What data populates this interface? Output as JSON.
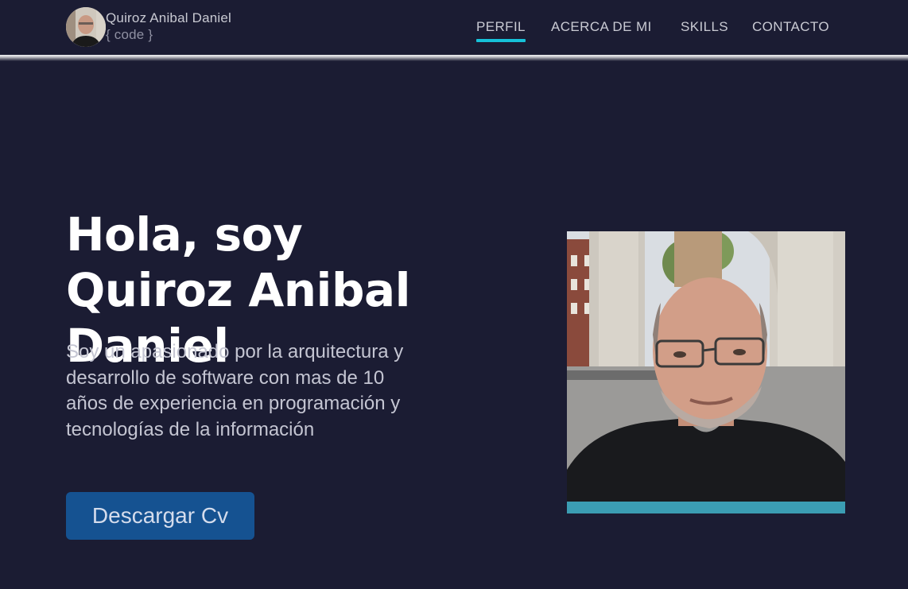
{
  "brand": {
    "name": "Quiroz Anibal Daniel",
    "tagline": "{ code }"
  },
  "nav": {
    "items": [
      {
        "label": "PERFIL",
        "active": true
      },
      {
        "label": "ACERCA DE MI",
        "active": false
      },
      {
        "label": "SKILLS",
        "active": false
      },
      {
        "label": "CONTACTO",
        "active": false
      }
    ]
  },
  "hero": {
    "greeting": "Hola, soy",
    "name": "Quiroz Anibal Daniel",
    "description": "Soy un apasionado por la arquitectura y desarrollo de software con mas de 10 años de experiencia en programación y tecnologías de la información",
    "button_label": "Descargar Cv"
  },
  "colors": {
    "background": "#1b1c33",
    "accent": "#16c1d9",
    "button": "#155291",
    "photo_bar": "#3b9db3"
  }
}
